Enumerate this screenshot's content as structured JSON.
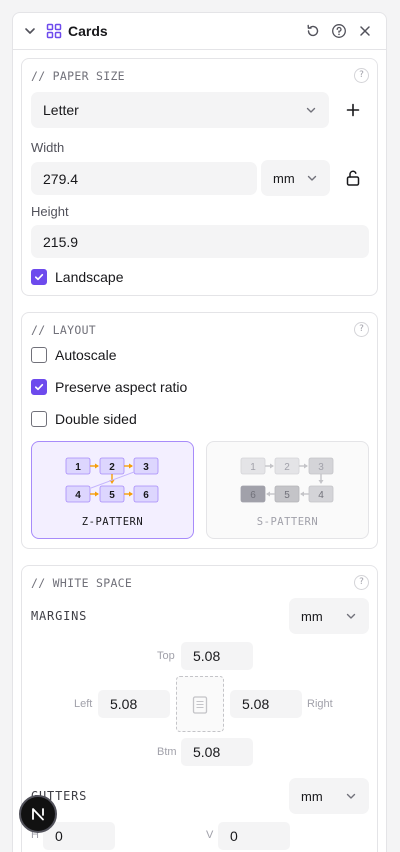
{
  "header": {
    "title": "Cards"
  },
  "paper": {
    "section_title": "// PAPER SIZE",
    "preset": "Letter",
    "width_label": "Width",
    "width_value": "279.4",
    "unit": "mm",
    "height_label": "Height",
    "height_value": "215.9",
    "landscape_label": "Landscape",
    "landscape_checked": true
  },
  "layout": {
    "section_title": "// LAYOUT",
    "autoscale_label": "Autoscale",
    "autoscale_checked": false,
    "preserve_label": "Preserve aspect ratio",
    "preserve_checked": true,
    "double_label": "Double sided",
    "double_checked": false,
    "patterns": [
      {
        "label": "Z-PATTERN",
        "selected": true,
        "cells": [
          "1",
          "2",
          "3",
          "4",
          "5",
          "6"
        ]
      },
      {
        "label": "S-PATTERN",
        "selected": false,
        "cells": [
          "1",
          "2",
          "3",
          "6",
          "5",
          "4"
        ]
      }
    ]
  },
  "whitespace": {
    "section_title": "// WHITE SPACE",
    "margins_label": "MARGINS",
    "margins_unit": "mm",
    "top_label": "Top",
    "top_value": "5.08",
    "left_label": "Left",
    "left_value": "5.08",
    "right_label": "Right",
    "right_value": "5.08",
    "bottom_label": "Btm",
    "bottom_value": "5.08",
    "gutters_label": "GUTTERS",
    "gutters_unit": "mm",
    "h_label": "H",
    "h_value": "0",
    "v_label": "V",
    "v_value": "0"
  },
  "colors": {
    "accent": "#6d4aed",
    "pattern_orange": "#f59e0b"
  }
}
